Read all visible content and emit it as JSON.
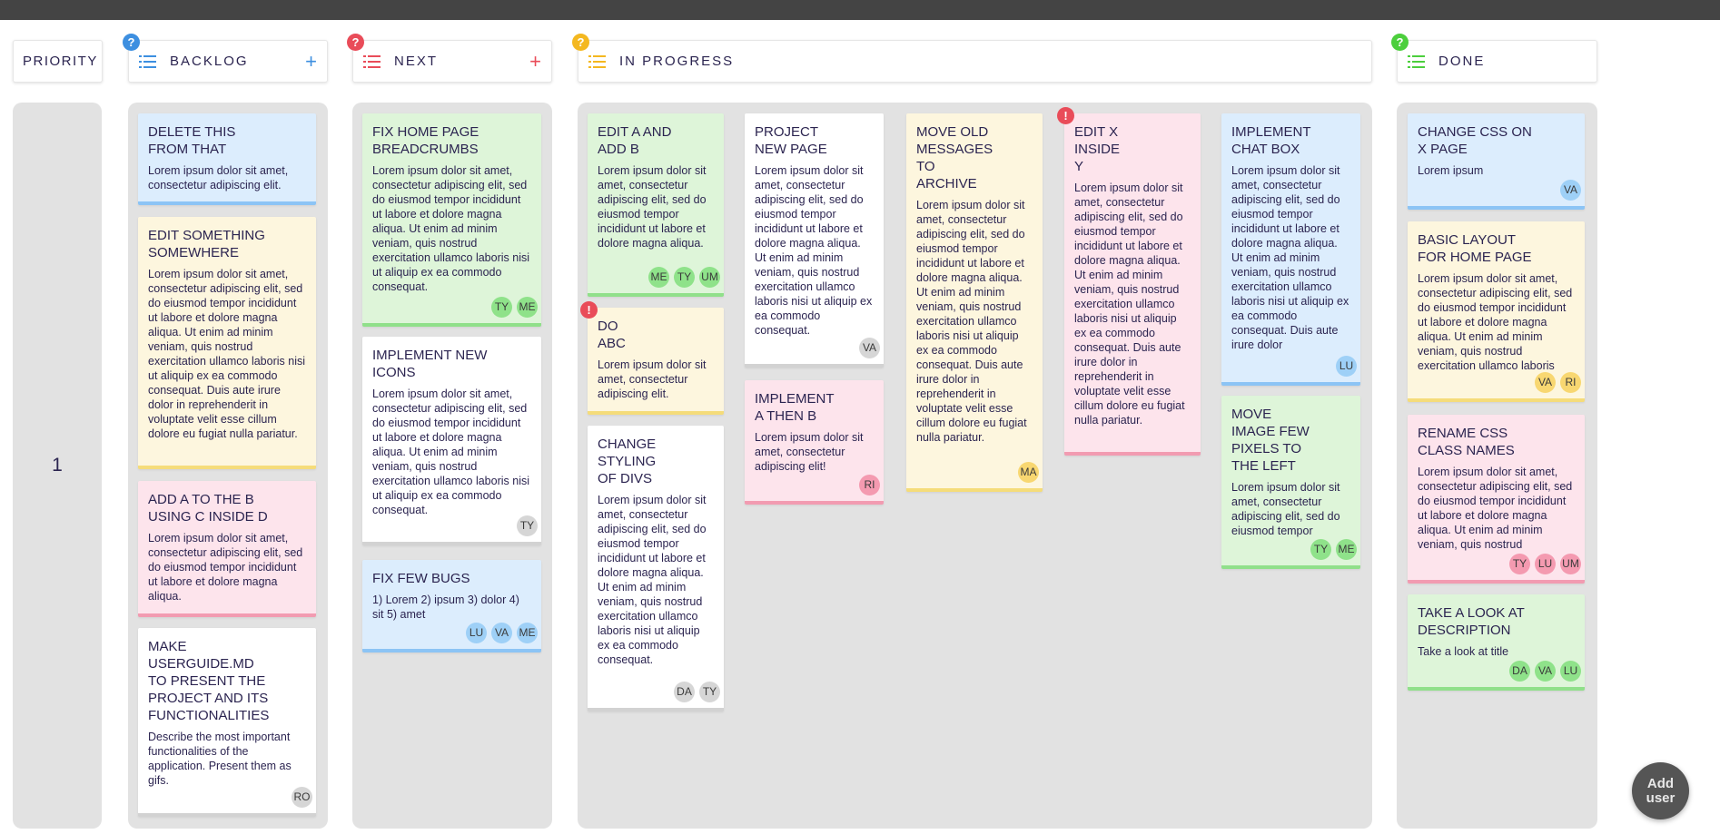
{
  "colors": {
    "blue": "#3d8fe0",
    "red": "#e94c59",
    "yellow": "#f4b820",
    "green": "#4ccf3d",
    "dark": "#2b2450"
  },
  "headers": {
    "priority": "PRIORITY",
    "backlog": {
      "title": "BACKLOG",
      "add": "+",
      "help": "?"
    },
    "next": {
      "title": "NEXT",
      "add": "+",
      "help": "?"
    },
    "in_progress": {
      "title": "IN PROGRESS",
      "help": "?"
    },
    "done": {
      "title": "DONE",
      "help": "?"
    }
  },
  "priority_value": "1",
  "cards": {
    "backlog": [
      {
        "title": "DELETE THIS\nFROM THAT",
        "desc": "Lorem ipsum dolor sit amet, consectetur adipiscing elit.",
        "avatars": []
      },
      {
        "title": "EDIT SOMETHING\nSOMEWHERE",
        "desc": "Lorem ipsum dolor sit amet, consectetur adipiscing elit, sed do eiusmod tempor incididunt ut labore et dolore magna aliqua. Ut enim ad minim veniam, quis nostrud exercitation ullamco laboris nisi ut aliquip ex ea commodo consequat. Duis aute irure dolor in reprehenderit in voluptate velit esse cillum dolore eu fugiat nulla pariatur.",
        "avatars": []
      },
      {
        "title": "ADD A TO THE B\nUSING C INSIDE D",
        "desc": "Lorem ipsum dolor sit amet, consectetur adipiscing elit, sed do eiusmod tempor incididunt ut labore et dolore magna aliqua.",
        "avatars": []
      },
      {
        "title": "MAKE\nUSERGUIDE.MD\nTO PRESENT THE\nPROJECT AND ITS\nFUNCTIONALITIES",
        "desc": "Describe the most important functionalities of the application. Present them as gifs.",
        "avatars": [
          "RO"
        ]
      }
    ],
    "next": [
      {
        "title": "FIX HOME PAGE\nBREADCRUMBS",
        "desc": "Lorem ipsum dolor sit amet, consectetur adipiscing elit, sed do eiusmod tempor incididunt ut labore et dolore magna aliqua. Ut enim ad minim veniam, quis nostrud exercitation ullamco laboris nisi ut aliquip ex ea commodo consequat.",
        "avatars": [
          "TY",
          "ME"
        ]
      },
      {
        "title": "IMPLEMENT NEW\nICONS",
        "desc": "Lorem ipsum dolor sit amet, consectetur adipiscing elit, sed do eiusmod tempor incididunt ut labore et dolore magna aliqua. Ut enim ad minim veniam, quis nostrud exercitation ullamco laboris nisi ut aliquip ex ea commodo consequat.",
        "avatars": [
          "TY"
        ]
      },
      {
        "title": "FIX FEW BUGS",
        "desc": "1) Lorem 2) ipsum 3) dolor 4) sit 5) amet",
        "avatars": [
          "LU",
          "VA",
          "ME"
        ]
      }
    ],
    "in_progress": [
      {
        "title": "EDIT A AND\nADD B",
        "desc": "Lorem ipsum dolor sit amet, consectetur adipiscing elit, sed do eiusmod tempor incididunt ut labore et dolore magna aliqua.",
        "avatars": [
          "ME",
          "TY",
          "UM"
        ]
      },
      {
        "title": "DO\nABC",
        "desc": "Lorem ipsum dolor sit amet, consectetur adipiscing elit.",
        "avatars": [],
        "alert": "!"
      },
      {
        "title": "CHANGE\nSTYLING\nOF DIVS",
        "desc": "Lorem ipsum dolor sit amet, consectetur adipiscing elit, sed do eiusmod tempor incididunt ut labore et dolore magna aliqua. Ut enim ad minim veniam, quis nostrud exercitation ullamco laboris nisi ut aliquip ex ea commodo consequat.",
        "avatars": [
          "DA",
          "TY"
        ]
      },
      {
        "title": "PROJECT\nNEW PAGE",
        "desc": "Lorem ipsum dolor sit amet, consectetur adipiscing elit, sed do eiusmod tempor incididunt ut labore et dolore magna aliqua. Ut enim ad minim veniam, quis nostrud exercitation ullamco laboris nisi ut aliquip ex ea commodo consequat.",
        "avatars": [
          "VA"
        ]
      },
      {
        "title": "IMPLEMENT\nA THEN B",
        "desc": "Lorem ipsum dolor sit amet, consectetur adipiscing elit!",
        "avatars": [
          "RI"
        ]
      },
      {
        "title": "MOVE OLD\nMESSAGES\nTO\nARCHIVE",
        "desc": "Lorem ipsum dolor sit amet, consectetur adipiscing elit, sed do eiusmod tempor incididunt ut labore et dolore magna aliqua. Ut enim ad minim veniam, quis nostrud exercitation ullamco laboris nisi ut aliquip ex ea commodo consequat. Duis aute irure dolor in reprehenderit in voluptate velit esse cillum dolore eu fugiat nulla pariatur.",
        "avatars": [
          "MA"
        ]
      },
      {
        "title": "EDIT X\nINSIDE\nY",
        "desc": "Lorem ipsum dolor sit amet, consectetur adipiscing elit, sed do eiusmod tempor incididunt ut labore et dolore magna aliqua. Ut enim ad minim veniam, quis nostrud exercitation ullamco laboris nisi ut aliquip ex ea commodo consequat. Duis aute irure dolor in reprehenderit in voluptate velit esse cillum dolore eu fugiat nulla pariatur.",
        "avatars": [],
        "alert": "!"
      },
      {
        "title": "IMPLEMENT\nCHAT BOX",
        "desc": "Lorem ipsum dolor sit amet, consectetur adipiscing elit, sed do eiusmod tempor incididunt ut labore et dolore magna aliqua. Ut enim ad minim veniam, quis nostrud exercitation ullamco laboris nisi ut aliquip ex ea commodo consequat. Duis aute irure dolor",
        "avatars": [
          "LU"
        ]
      },
      {
        "title": "MOVE\nIMAGE FEW\nPIXELS TO\nTHE LEFT",
        "desc": "Lorem ipsum dolor sit amet, consectetur adipiscing elit, sed do eiusmod tempor",
        "avatars": [
          "TY",
          "ME"
        ]
      }
    ],
    "done": [
      {
        "title": "CHANGE CSS ON\nX PAGE",
        "desc": "Lorem ipsum",
        "avatars": [
          "VA"
        ]
      },
      {
        "title": "BASIC LAYOUT\nFOR HOME PAGE",
        "desc": "Lorem ipsum dolor sit amet, consectetur adipiscing elit, sed do eiusmod tempor incididunt ut labore et dolore magna aliqua. Ut enim ad minim veniam, quis nostrud exercitation ullamco laboris",
        "avatars": [
          "VA",
          "RI"
        ]
      },
      {
        "title": "RENAME CSS\nCLASS NAMES",
        "desc": "Lorem ipsum dolor sit amet, consectetur adipiscing elit, sed do eiusmod tempor incididunt ut labore et dolore magna aliqua. Ut enim ad minim veniam, quis nostrud",
        "avatars": [
          "TY",
          "LU",
          "UM"
        ]
      },
      {
        "title": "TAKE A LOOK AT\nDESCRIPTION",
        "desc": "Take a look at title",
        "avatars": [
          "DA",
          "VA",
          "LU"
        ]
      }
    ]
  },
  "fab_label": "Add\nuser"
}
